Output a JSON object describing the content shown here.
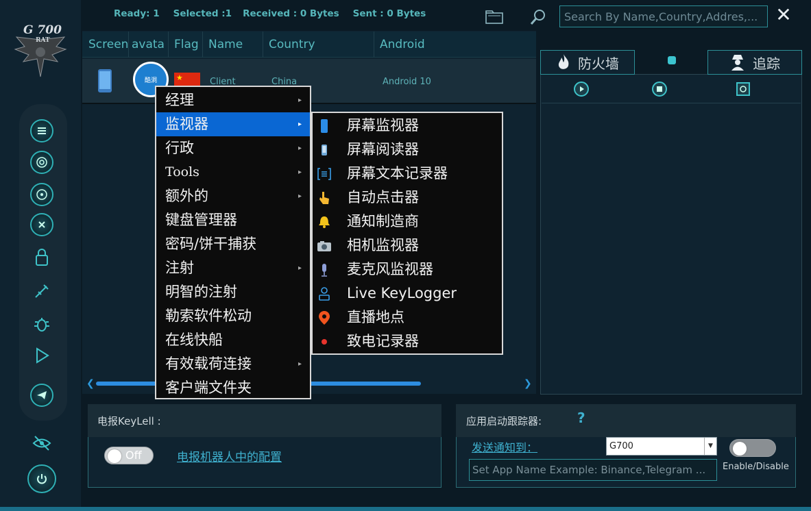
{
  "app": {
    "logo_text": "G 700",
    "logo_sub": "RAT"
  },
  "status": {
    "ready": "Ready: 1",
    "selected": "Selected :1",
    "received": "Received : 0 Bytes",
    "sent": "Sent : 0 Bytes"
  },
  "search": {
    "placeholder": "Search By Name,Country,Addres,..."
  },
  "close": {
    "label": "✕"
  },
  "table": {
    "headers": [
      "Screen",
      "avata",
      "Flag",
      "Name",
      "Country",
      "Android"
    ],
    "row": {
      "avatar_text": "酷洞",
      "name": "Client",
      "country": "China",
      "android": "Android 10"
    }
  },
  "right": {
    "firewall_label": "防火墙",
    "tracker_label": "追踪"
  },
  "context_menu": {
    "items": [
      {
        "label": "经理",
        "submenu": true
      },
      {
        "label": "监视器",
        "submenu": true,
        "selected": true
      },
      {
        "label": "行政",
        "submenu": true
      },
      {
        "label": "Tools",
        "submenu": true
      },
      {
        "label": "额外的",
        "submenu": true
      },
      {
        "label": "键盘管理器",
        "submenu": false
      },
      {
        "label": "密码/饼干捕获",
        "submenu": false
      },
      {
        "label": "注射",
        "submenu": true
      },
      {
        "label": "明智的注射",
        "submenu": false
      },
      {
        "label": "勒索软件松动",
        "submenu": false
      },
      {
        "label": "在线快船",
        "submenu": false
      },
      {
        "label": "有效载荷连接",
        "submenu": true
      },
      {
        "label": "客户端文件夹",
        "submenu": false
      }
    ],
    "arrow": "▸"
  },
  "submenu": {
    "items": [
      {
        "label": "屏幕监视器",
        "icon": "phone-icon"
      },
      {
        "label": "屏幕阅读器",
        "icon": "phone-small-icon"
      },
      {
        "label": "屏幕文本记录器",
        "icon": "text-bracket-icon"
      },
      {
        "label": "自动点击器",
        "icon": "pointer-hand-icon"
      },
      {
        "label": "通知制造商",
        "icon": "bell-icon"
      },
      {
        "label": "相机监视器",
        "icon": "camera-icon"
      },
      {
        "label": "麦克风监视器",
        "icon": "microphone-icon"
      },
      {
        "label": "Live KeyLogger",
        "icon": "keylogger-icon"
      },
      {
        "label": "直播地点",
        "icon": "location-pin-icon"
      },
      {
        "label": "致电记录器",
        "icon": "red-dot-icon"
      }
    ]
  },
  "telegram": {
    "title": "电报KeyLell :",
    "toggle_label": "Off",
    "config_link": "电报机器人中的配置"
  },
  "app_tracker": {
    "title": "应用启动跟踪器:",
    "help": "?",
    "send_link": "发送通知到：",
    "select_value": "G700",
    "select_arrow": "▼",
    "input_placeholder": "Set App Name Example: Binance,Telegram ...",
    "enable_label": "Enable/Disable"
  },
  "colors": {
    "accent": "#2fb0b5",
    "menu_highlight": "#0a67d3",
    "teal_text": "#56b6ba"
  }
}
